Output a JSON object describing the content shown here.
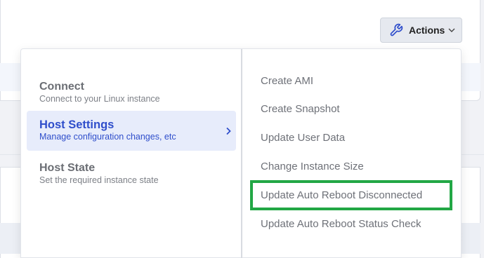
{
  "header": {
    "actions_label": "Actions",
    "actions_icon": "wrench-icon",
    "accent_color": "#2f4ecb"
  },
  "menu": {
    "left_items": [
      {
        "title": "Connect",
        "subtitle": "Connect to your Linux instance",
        "active": false
      },
      {
        "title": "Host Settings",
        "subtitle": "Manage configuration changes, etc",
        "active": true
      },
      {
        "title": "Host State",
        "subtitle": "Set the required instance state",
        "active": false
      }
    ],
    "right_items": [
      {
        "label": "Create AMI"
      },
      {
        "label": "Create Snapshot"
      },
      {
        "label": "Update User Data"
      },
      {
        "label": "Change Instance Size"
      },
      {
        "label": "Update Auto Reboot Disconnected",
        "highlighted": true
      },
      {
        "label": "Update Auto Reboot Status Check"
      }
    ]
  },
  "colors": {
    "highlight_border": "#22a745",
    "active_bg": "#e7ecfb"
  }
}
